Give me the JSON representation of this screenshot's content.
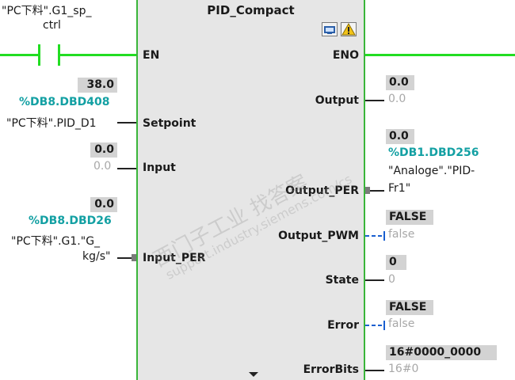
{
  "block": {
    "title": "PID_Compact",
    "pins_left": {
      "en": "EN",
      "setpoint": "Setpoint",
      "input": "Input",
      "input_per": "Input_PER"
    },
    "pins_right": {
      "eno": "ENO",
      "output": "Output",
      "output_per": "Output_PER",
      "output_pwm": "Output_PWM",
      "state": "State",
      "error": "Error",
      "errorbits": "ErrorBits"
    }
  },
  "en_contact": {
    "tag_line1": "\"PC下料\".G1_sp_",
    "tag_line2": "ctrl"
  },
  "setpoint": {
    "value": "38.0",
    "address": "%DB8.DBD408",
    "tag": "\"PC下料\".PID_D1"
  },
  "input": {
    "value": "0.0",
    "param": "0.0"
  },
  "input_per": {
    "value": "0.0",
    "address": "%DB8.DBD26",
    "tag_line1": "\"PC下料\".G1.\"G_",
    "tag_line2": "kg/s\""
  },
  "output": {
    "value": "0.0",
    "param": "0.0"
  },
  "output_per": {
    "value": "0.0",
    "address": "%DB1.DBD256",
    "tag_line1": "\"Analoge\".\"PID-",
    "tag_line2": "Fr1\""
  },
  "output_pwm": {
    "value": "FALSE",
    "param": "false"
  },
  "state": {
    "value": "0",
    "param": "0"
  },
  "error": {
    "value": "FALSE",
    "param": "false"
  },
  "errorbits": {
    "value": "16#0000_0000",
    "param": "16#0"
  },
  "watermark": {
    "line1": "西门子工业 找答案",
    "line2": "support.industry.siemens.com/cs"
  },
  "colors": {
    "rail": "#22dd22",
    "block_border": "#3ab53a",
    "address": "#13a0a3",
    "block_bg": "#e6e6e6"
  }
}
